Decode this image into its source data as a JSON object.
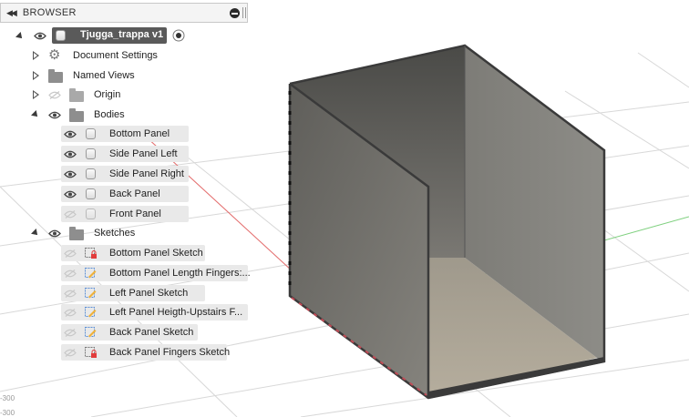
{
  "browser": {
    "title": "BROWSER",
    "root": "Tjugga_trappa v1",
    "items": {
      "document_settings": "Document Settings",
      "named_views": "Named Views",
      "origin": "Origin",
      "bodies": "Bodies",
      "sketches": "Sketches"
    },
    "bodies": [
      "Bottom Panel",
      "Side Panel Left",
      "Side Panel Right",
      "Back Panel",
      "Front Panel"
    ],
    "sketches": [
      "Bottom Panel Sketch",
      "Bottom Panel Length Fingers:...",
      "Left Panel Sketch",
      "Left Panel Heigth-Upstairs F...",
      "Back Panel Sketch",
      "Back Panel Fingers Sketch"
    ]
  },
  "viewport": {
    "grid_label_left": "-300",
    "grid_label_bottom": "-300"
  },
  "colors": {
    "accent": "#606060",
    "panel": "#e9e9e9",
    "red_axis": "#e36a6a",
    "green_axis": "#7fd07f",
    "box_outer": "#8c8c88",
    "box_edge": "#3a3a3a"
  },
  "icons": {
    "eye": "eye-icon",
    "folder": "folder-icon",
    "gear": "gear-icon",
    "body": "body-icon",
    "sketch": "sketch-icon"
  }
}
